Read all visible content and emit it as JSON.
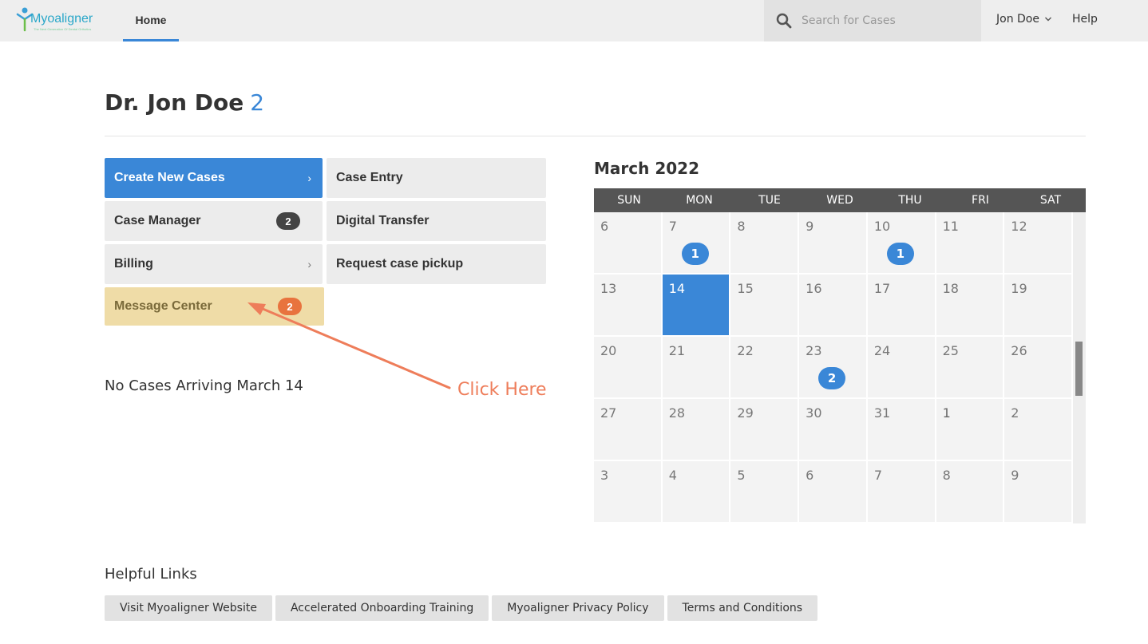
{
  "header": {
    "logo_text": "Myoaligner",
    "logo_tagline": "The Next Generation Of Dental Orthotics",
    "nav_home": "Home",
    "search_placeholder": "Search for Cases",
    "user_name": "Jon Doe",
    "help": "Help"
  },
  "title": {
    "name": "Dr. Jon Doe",
    "count": "2"
  },
  "menu": {
    "create_new_cases": "Create New Cases",
    "case_entry": "Case Entry",
    "case_manager": "Case Manager",
    "case_manager_badge": "2",
    "digital_transfer": "Digital Transfer",
    "billing": "Billing",
    "request_case_pickup": "Request case pickup",
    "message_center": "Message Center",
    "message_center_badge": "2"
  },
  "no_cases_text": "No Cases Arriving March 14",
  "annotation": "Click Here",
  "calendar": {
    "title": "March 2022",
    "days": [
      "SUN",
      "MON",
      "TUE",
      "WED",
      "THU",
      "FRI",
      "SAT"
    ],
    "weeks": [
      [
        {
          "d": "6"
        },
        {
          "d": "7",
          "count": "1"
        },
        {
          "d": "8"
        },
        {
          "d": "9"
        },
        {
          "d": "10",
          "count": "1"
        },
        {
          "d": "11"
        },
        {
          "d": "12"
        }
      ],
      [
        {
          "d": "13"
        },
        {
          "d": "14",
          "today": true
        },
        {
          "d": "15"
        },
        {
          "d": "16"
        },
        {
          "d": "17"
        },
        {
          "d": "18"
        },
        {
          "d": "19"
        }
      ],
      [
        {
          "d": "20"
        },
        {
          "d": "21"
        },
        {
          "d": "22"
        },
        {
          "d": "23",
          "count": "2"
        },
        {
          "d": "24"
        },
        {
          "d": "25"
        },
        {
          "d": "26"
        }
      ],
      [
        {
          "d": "27"
        },
        {
          "d": "28"
        },
        {
          "d": "29"
        },
        {
          "d": "30"
        },
        {
          "d": "31"
        },
        {
          "d": "1",
          "other": true
        },
        {
          "d": "2"
        }
      ],
      [
        {
          "d": "3"
        },
        {
          "d": "4"
        },
        {
          "d": "5"
        },
        {
          "d": "6"
        },
        {
          "d": "7"
        },
        {
          "d": "8"
        },
        {
          "d": "9"
        }
      ]
    ]
  },
  "helpful_links": {
    "title": "Helpful Links",
    "links": [
      "Visit Myoaligner Website",
      "Accelerated Onboarding Training",
      "Myoaligner Privacy Policy",
      "Terms and Conditions"
    ]
  },
  "colors": {
    "accent": "#3a87d7",
    "highlight": "#efdca7",
    "annotation": "#ee7d5a"
  }
}
